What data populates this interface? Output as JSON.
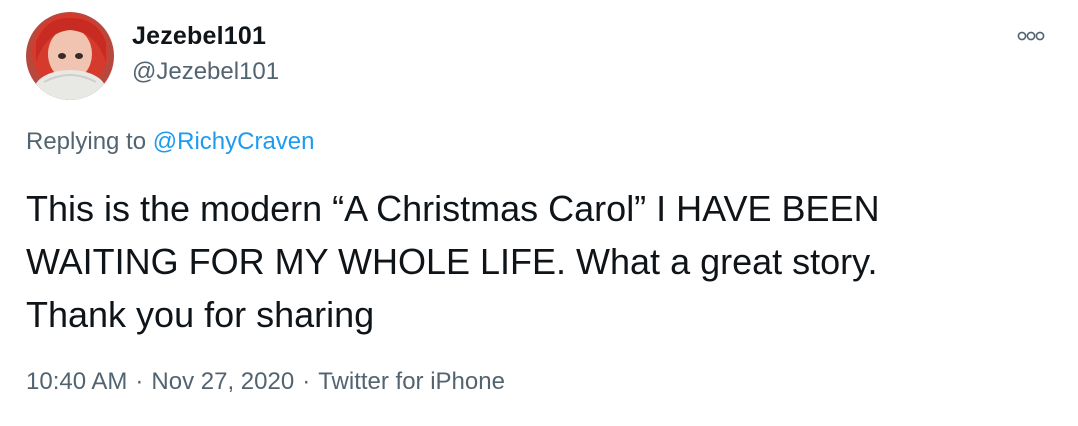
{
  "author": {
    "display_name": "Jezebel101",
    "handle": "@Jezebel101",
    "avatar_icon": "profile-photo-red-hair"
  },
  "more_icon": "more-options-icon",
  "reply": {
    "prefix": "Replying to",
    "to_handle": "@RichyCraven"
  },
  "tweet": {
    "line1": "This is the modern “A Christmas Carol” I HAVE BEEN",
    "line2": "WAITING FOR MY WHOLE LIFE. What a great story.",
    "line3": "Thank you for sharing"
  },
  "meta": {
    "time": "10:40 AM",
    "date": "Nov 27, 2020",
    "source": "Twitter for iPhone",
    "separator": "·"
  },
  "colors": {
    "text_primary": "#0f1419",
    "text_secondary": "#536471",
    "link": "#1d9bf0"
  }
}
